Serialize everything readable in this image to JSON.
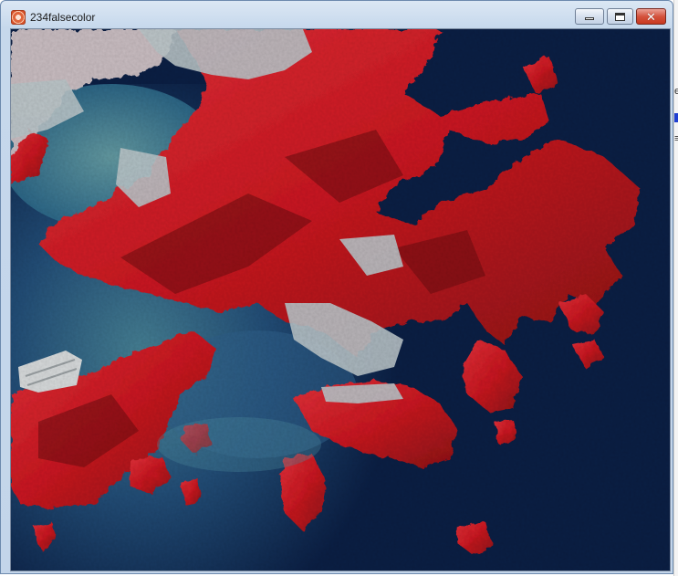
{
  "window": {
    "title": "234falsecolor",
    "icon": "app-icon",
    "controls": {
      "minimize": "minimize-icon",
      "maximize": "maximize-icon",
      "close": "close-icon",
      "close_glyph": "✕"
    }
  },
  "image": {
    "description_icon": "false-color-satellite-image",
    "colors": {
      "sea_deep": "#0b1f44",
      "sea_mid": "#1f4c7a",
      "sea_shallow": "#3c7e95",
      "vegetation": "#d01a22",
      "vegetation_dark": "#7a1014",
      "urban": "#b7c2c6",
      "airport": "#d9dcdc"
    }
  },
  "background_app": {
    "fragment_letter": "e",
    "fragment_glyph": "≡"
  }
}
